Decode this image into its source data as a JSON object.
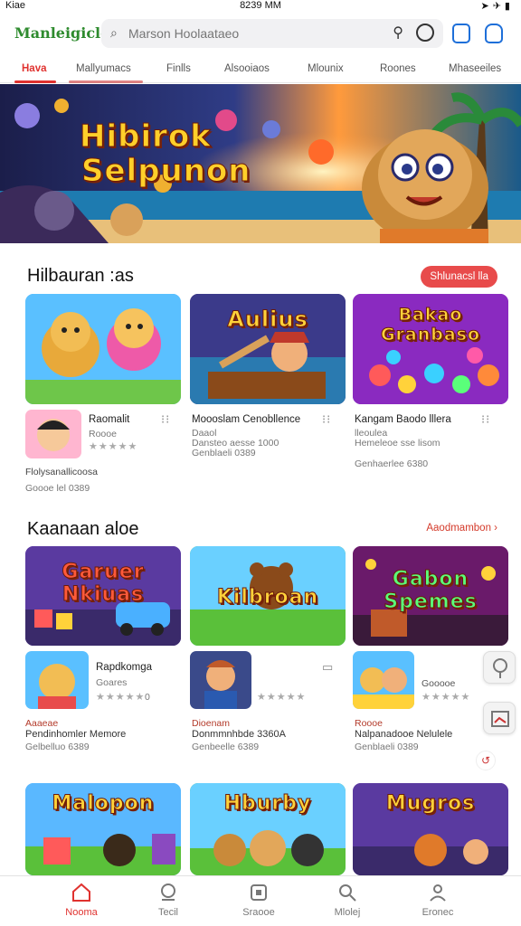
{
  "status_bar": {
    "carrier": "Kiae",
    "time": "8239 MM",
    "icons": [
      "wifi-icon",
      "location-icon",
      "signal-icon",
      "battery-icon"
    ]
  },
  "header": {
    "logo": "Manleigicle",
    "search_placeholder": "Marson Hoolaataeo"
  },
  "tabs": [
    {
      "label": "Hava",
      "active": true
    },
    {
      "label": "Mallyumacs",
      "active": false
    },
    {
      "label": "Finlls",
      "active": false
    },
    {
      "label": "Alsooiaos",
      "active": false
    },
    {
      "label": "Mlounix",
      "active": false
    },
    {
      "label": "Roones",
      "active": false
    },
    {
      "label": "Mhaseeiles",
      "active": false
    }
  ],
  "banner": {
    "title_line1": "Hibirok",
    "title_line2": "Selpunon"
  },
  "section1": {
    "title": "Hilbauran :as",
    "pill": "Shlunacsl lla",
    "cards": [
      {
        "thumb_title": "",
        "icon": "bear-kids-icon",
        "name": "Raomalit",
        "sub1": "Roooe",
        "stars": "★★★★★",
        "rating": 3,
        "line1": "Flolysanallicoosa",
        "line2": "Goooe lel 0389"
      },
      {
        "thumb_title": "Aulius",
        "name": "Moooslam Cenobllence",
        "sub1": "Daaol",
        "sub2": "Dansteo aesse 1000",
        "sub3": "Genblaeli 0389"
      },
      {
        "thumb_title": "Bakao Granbaso",
        "name": "Kangam Baodo lllera",
        "sub1": "lleoulea",
        "sub2": "Hemeleoe sse lisom",
        "sub3": "Genhaerlee 6380"
      }
    ]
  },
  "section2": {
    "title": "Kaanaan aloe",
    "link": "Aaodmambon",
    "cards": [
      {
        "thumb_title": "Garuer Nkiuas",
        "name": "Rapdkomga",
        "sub1": "Goares",
        "stars": "★★★★★",
        "rating": 3,
        "score": "0",
        "red": "Aaaeae",
        "desc": "Pendinhomler Memore",
        "sub3": "Gelbelluo 6389"
      },
      {
        "thumb_title": "Kilbroan",
        "stars": "★★★★★",
        "rating": 3,
        "red": "Dioenam",
        "desc": "Donmmnhbde 3360A",
        "sub3": "Genbeelle 6389"
      },
      {
        "thumb_title": "Gabon Spemes",
        "name": "Gooooe",
        "stars": "★★★★★",
        "rating": 3,
        "red": "Roooe",
        "desc": "Nalpanadooe Nelulele",
        "sub3": "Genblaeli 0389"
      }
    ]
  },
  "section3": {
    "cards": [
      {
        "thumb_title": "Malopon"
      },
      {
        "thumb_title": "Hburby"
      },
      {
        "thumb_title": "Mugros"
      }
    ]
  },
  "bottom_nav": [
    {
      "label": "Nooma",
      "icon": "home-icon",
      "active": true
    },
    {
      "label": "Tecil",
      "icon": "controller-icon",
      "active": false
    },
    {
      "label": "Sraooe",
      "icon": "store-icon",
      "active": false
    },
    {
      "label": "Mlolej",
      "icon": "search-icon",
      "active": false
    },
    {
      "label": "Eronec",
      "icon": "profile-icon",
      "active": false
    }
  ],
  "colors": {
    "accent": "#e0322f",
    "logo_green": "#2e8b2e",
    "link_blue": "#1e6fd9"
  }
}
